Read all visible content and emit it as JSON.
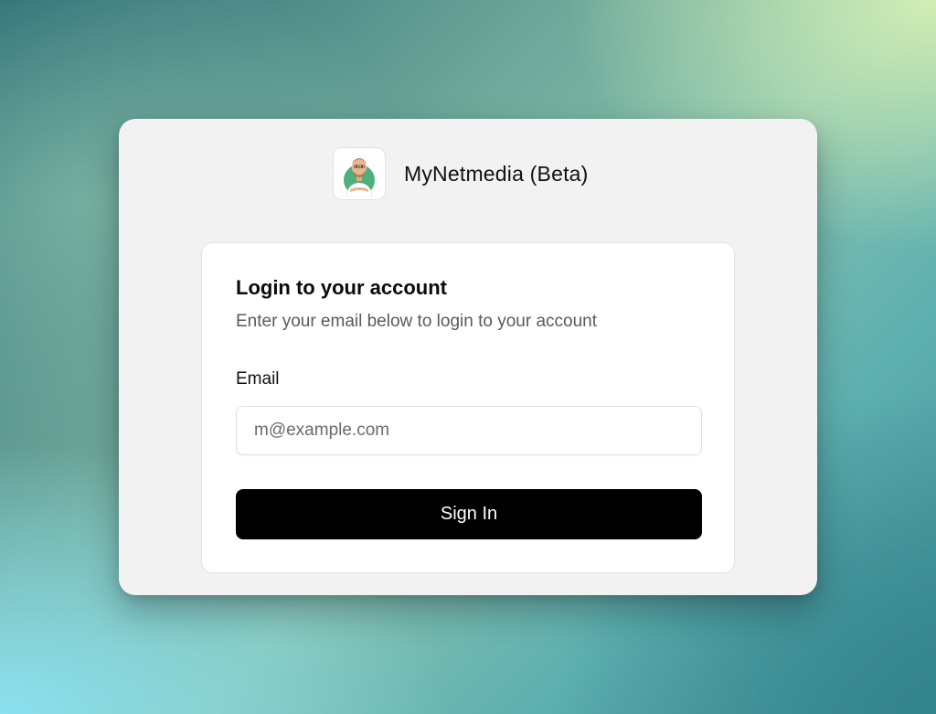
{
  "brand": {
    "name": "MyNetmedia (Beta)",
    "logo_icon": "avatar-cartoon-icon"
  },
  "login": {
    "title": "Login to your account",
    "subtitle": "Enter your email below to login to your account",
    "email_label": "Email",
    "email_placeholder": "m@example.com",
    "email_value": "",
    "submit_label": "Sign In"
  },
  "colors": {
    "button_bg": "#000000",
    "button_text": "#ffffff",
    "card_bg": "#f2f2f2",
    "inner_card_bg": "#ffffff",
    "logo_accent": "#4caf7d"
  }
}
